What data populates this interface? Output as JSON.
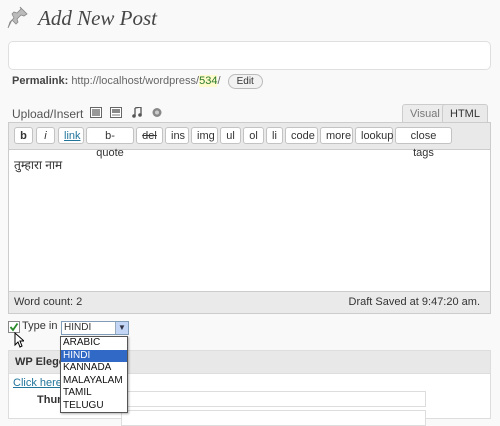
{
  "page_title": "Add New Post",
  "permalink": {
    "label": "Permalink:",
    "url_prefix": "http://localhost/wordpress/",
    "slug": "534",
    "url_suffix": "/",
    "edit_label": "Edit"
  },
  "upload": {
    "label": "Upload/Insert"
  },
  "tabs": {
    "visual": "Visual",
    "html": "HTML"
  },
  "quicktags": [
    "b",
    "i",
    "link",
    "b-quote",
    "del",
    "ins",
    "img",
    "ul",
    "ol",
    "li",
    "code",
    "more",
    "lookup",
    "close tags"
  ],
  "editor": {
    "content": "तुम्हारा नाम"
  },
  "status": {
    "word_count": "Word count: 2",
    "draft_saved": "Draft Saved at 9:47:20 am."
  },
  "type_in": {
    "label": "Type in",
    "selected": "HINDI",
    "checked": true
  },
  "languages": [
    "ARABIC",
    "HINDI",
    "KANNADA",
    "MALAYALAM",
    "TAMIL",
    "TELUGU"
  ],
  "panel": {
    "heading": "WP Elego",
    "link": "Click here f",
    "thumb_label": "Thum"
  }
}
